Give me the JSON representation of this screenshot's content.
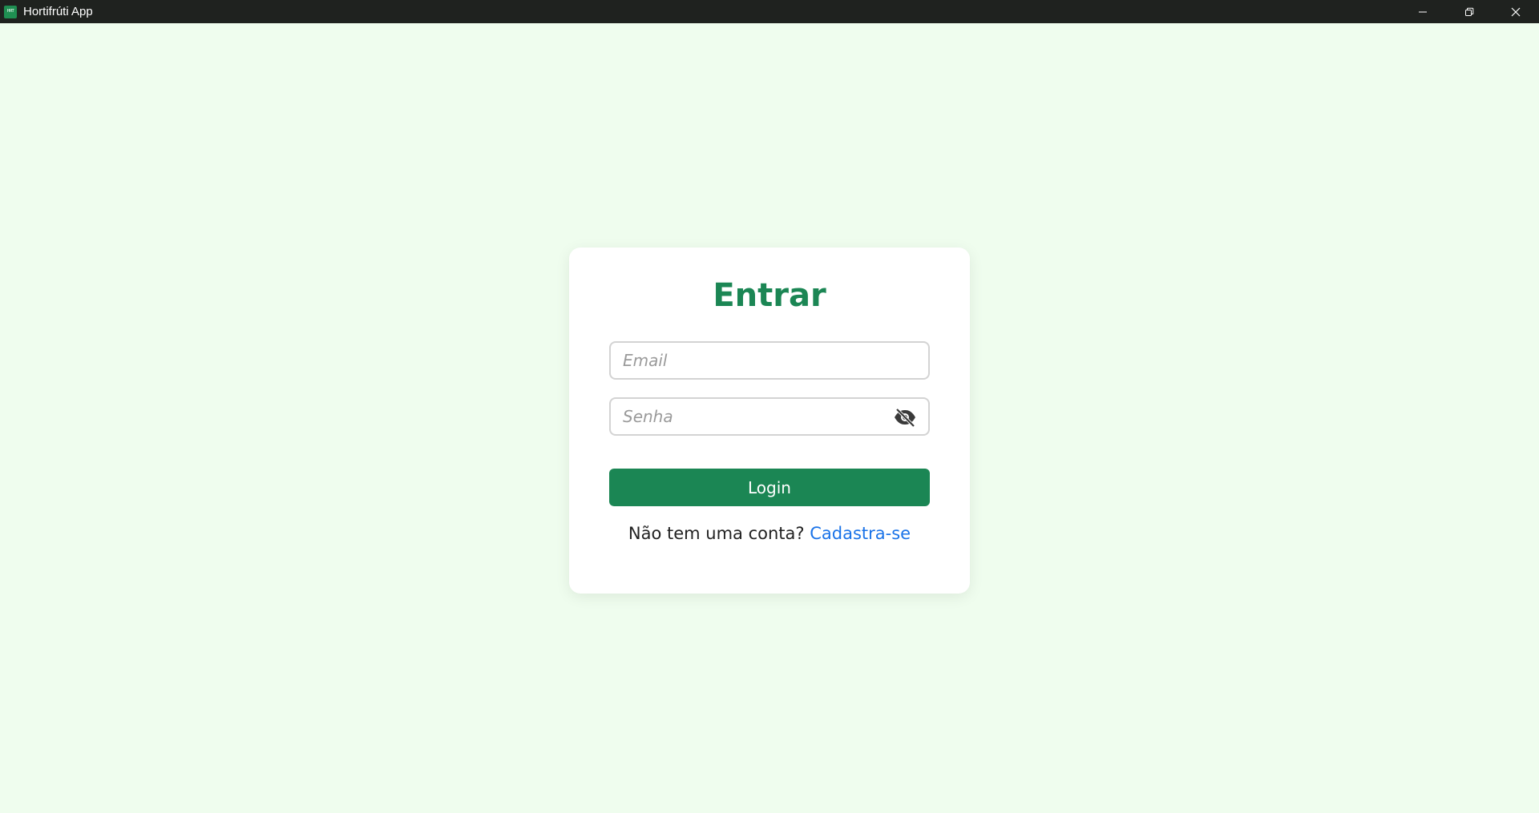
{
  "window": {
    "title": "Hortifrúti App",
    "icon_text": "HRT",
    "controls": {
      "minimize_icon": "minimize-icon",
      "restore_icon": "restore-icon",
      "close_icon": "close-icon"
    }
  },
  "login": {
    "heading": "Entrar",
    "email_placeholder": "Email",
    "email_value": "",
    "password_placeholder": "Senha",
    "password_value": "",
    "password_toggle_icon": "eye-slash-icon",
    "submit_label": "Login",
    "signup_prompt": "Não tem uma conta?",
    "signup_link": "Cadastra-se"
  },
  "colors": {
    "background": "#effdee",
    "titlebar": "#1f221f",
    "brand_green": "#1b8654",
    "link_blue": "#1a73e8"
  }
}
